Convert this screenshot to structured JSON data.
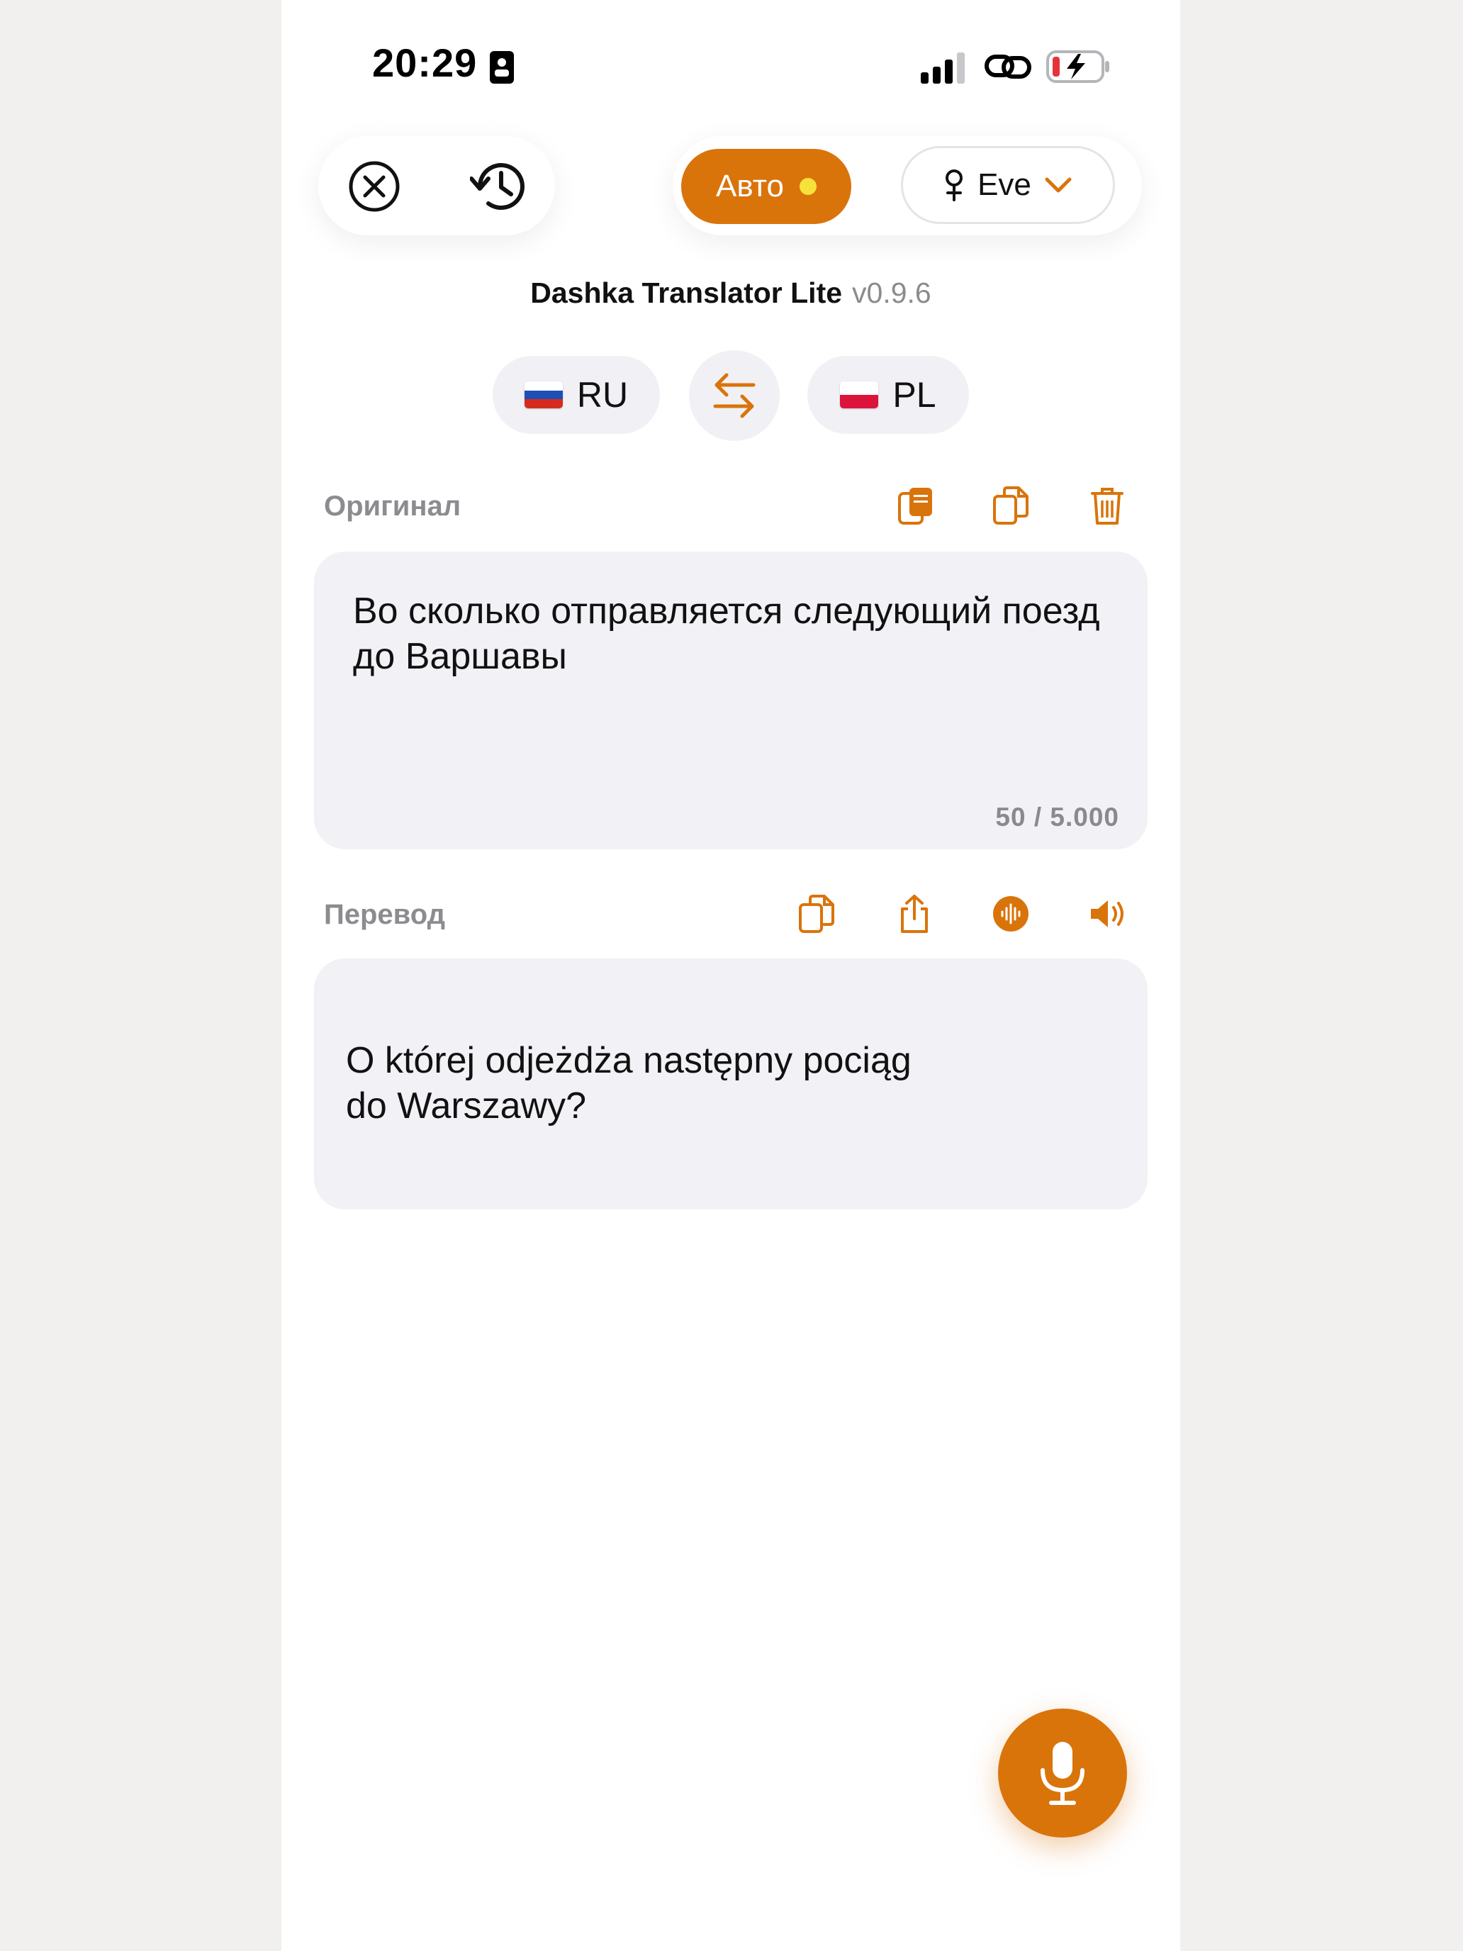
{
  "status_bar": {
    "time": "20:29",
    "icons": [
      "sim-card-icon",
      "signal-icon",
      "link-icon",
      "battery-charging-icon"
    ]
  },
  "top_bar": {
    "close_icon": "close-circle-icon",
    "history_icon": "history-icon",
    "auto_label": "Авто",
    "voice_icon": "female-icon",
    "voice_label": "Eve",
    "voice_chevron": "chevron-down-icon"
  },
  "app": {
    "name": "Dashka Translator Lite",
    "version": "v0.9.6"
  },
  "languages": {
    "source": "RU",
    "target": "PL",
    "swap_icon": "swap-arrows-icon"
  },
  "original": {
    "label": "Оригинал",
    "text": "Во сколько отправляется следующий поезд до Варшавы",
    "counter": "50 / 5.000",
    "actions": [
      "paste-icon",
      "copy-icon",
      "trash-icon"
    ]
  },
  "translation": {
    "label": "Перевод",
    "text": "O której odjeżdża następny pociąg\ndo Warszawy?",
    "actions": [
      "copy-icon",
      "share-icon",
      "waveform-icon",
      "speaker-icon"
    ]
  },
  "colors": {
    "accent": "#d9740b",
    "auto_dot": "#f7e23b",
    "box_bg": "#f1f1f6",
    "label_gray": "#8c8c90"
  },
  "mic_icon": "microphone-icon"
}
